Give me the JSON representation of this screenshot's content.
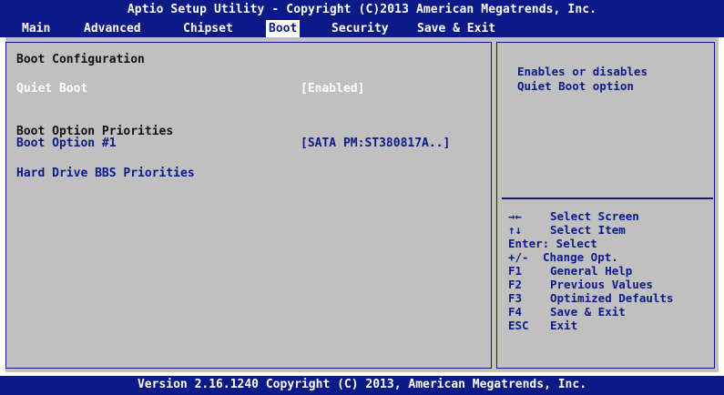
{
  "title": "Aptio Setup Utility - Copyright (C)2013 American Megatrends, Inc.",
  "tabs": [
    {
      "label": "Main"
    },
    {
      "label": "Advanced"
    },
    {
      "label": "Chipset"
    },
    {
      "label": "Boot",
      "active": true
    },
    {
      "label": "Security"
    },
    {
      "label": "Save & Exit"
    }
  ],
  "settings": {
    "boot_configuration_header": "Boot Configuration",
    "quiet_boot": {
      "label": "Quiet Boot",
      "value": "[Enabled]"
    },
    "boot_option_priorities_header": "Boot Option Priorities",
    "boot_option_1": {
      "label": "Boot Option #1",
      "value": "[SATA PM:ST380817A..]"
    },
    "hdd_bbs_priorities": "Hard Drive BBS Priorities"
  },
  "help": {
    "line1": "Enables or disables",
    "line2": "Quiet Boot option"
  },
  "keys": {
    "select_screen": {
      "key": "→←",
      "desc": "Select Screen"
    },
    "select_item": {
      "key": "↑↓",
      "desc": "Select Item"
    },
    "enter": "Enter: Select",
    "change": {
      "key": "+/-",
      "desc": "Change Opt."
    },
    "f1": {
      "key": "F1",
      "desc": "General Help"
    },
    "f2": {
      "key": "F2",
      "desc": "Previous Values"
    },
    "f3": {
      "key": "F3",
      "desc": "Optimized Defaults"
    },
    "f4": {
      "key": "F4",
      "desc": "Save & Exit"
    },
    "esc": {
      "key": "ESC",
      "desc": "Exit"
    }
  },
  "footer": "Version 2.16.1240 Copyright (C) 2013, American Megatrends, Inc.",
  "colors": {
    "bios_blue": "#0b1a86",
    "panel_grey": "#c0c0c0",
    "highlight_white": "#ffffff"
  }
}
